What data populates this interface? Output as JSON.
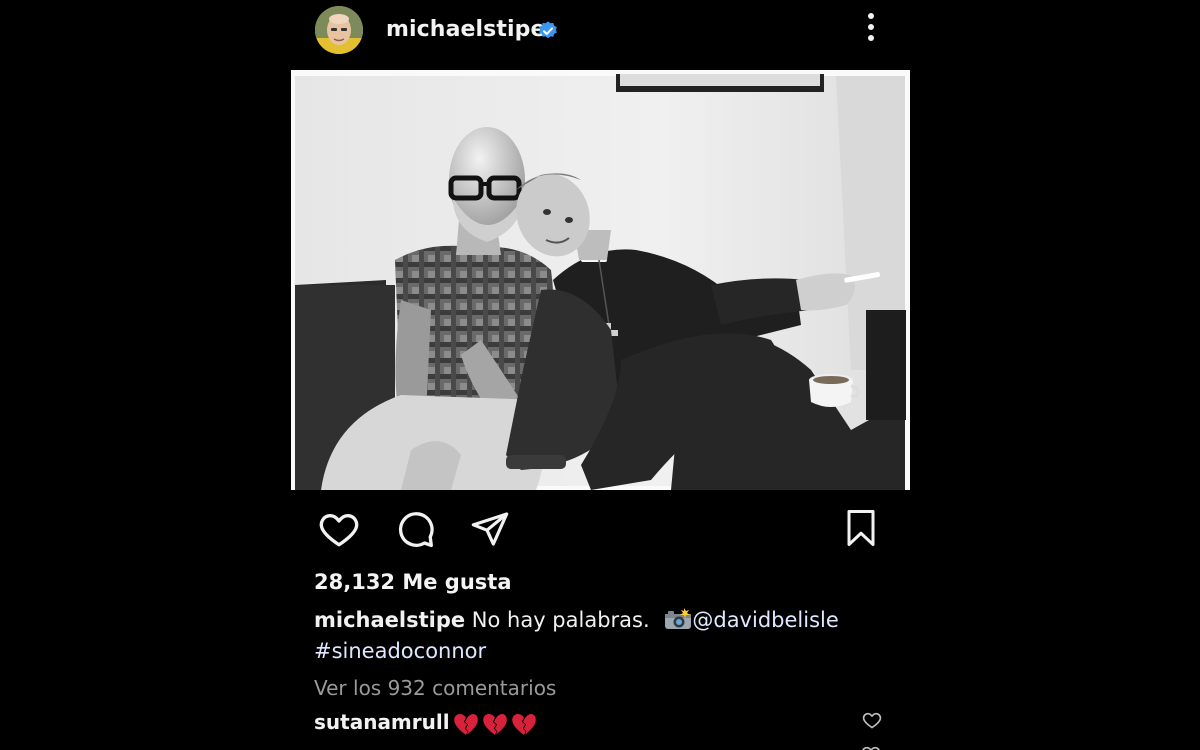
{
  "post": {
    "author": {
      "username": "michaelstipe",
      "verified": true,
      "avatar_icon": "profile-avatar"
    },
    "photo": {
      "alt_icon": "black-and-white-photo"
    },
    "actions": {
      "like_icon": "heart-outline-icon",
      "comment_icon": "comment-bubble-icon",
      "share_icon": "paper-plane-icon",
      "save_icon": "bookmark-icon"
    },
    "likes_text": "28,132 Me gusta",
    "caption": {
      "username": "michaelstipe",
      "text": "No hay palabras.",
      "mention": "@davidbelisle",
      "hashtag": "#sineadoconnor",
      "emoji_icon": "camera-flash-icon"
    },
    "view_comments_text": "Ver los 932 comentarios",
    "comments": [
      {
        "username": "sutanamrull",
        "emoji_icons": [
          "broken-heart-icon",
          "broken-heart-icon",
          "broken-heart-icon"
        ]
      }
    ]
  },
  "colors": {
    "background": "#000000",
    "text": "#f2f2f2",
    "muted": "#9a9a9a",
    "verified_blue": "#3897f0",
    "broken_heart_red": "#d8213a"
  }
}
